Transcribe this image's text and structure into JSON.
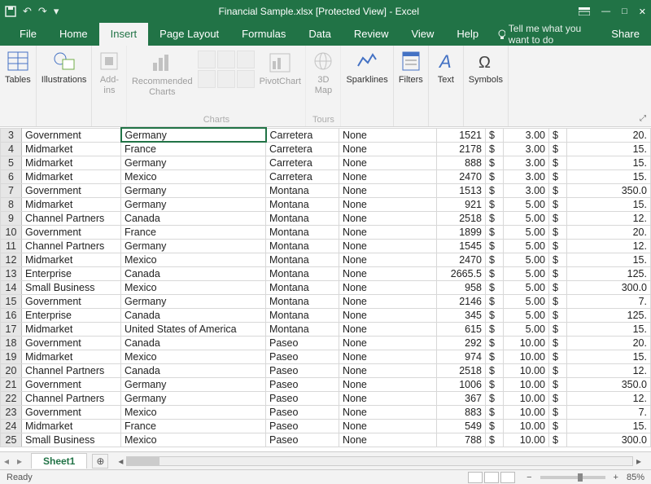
{
  "title": "Financial Sample.xlsx  [Protected View]  -  Excel",
  "qat": {
    "undo": "↶",
    "redo": "↷"
  },
  "menu": {
    "file": "File",
    "home": "Home",
    "insert": "Insert",
    "page_layout": "Page Layout",
    "formulas": "Formulas",
    "data": "Data",
    "review": "Review",
    "view": "View",
    "help": "Help",
    "tellme": "Tell me what you want to do",
    "share": "Share"
  },
  "ribbon": {
    "tables": "Tables",
    "illustrations": "Illustrations",
    "addins": "Add-\nins",
    "recommended": "Recommended\nCharts",
    "charts_group": "Charts",
    "pivotchart": "PivotChart",
    "map": "3D\nMap",
    "tours_group": "Tours",
    "sparklines": "Sparklines",
    "filters": "Filters",
    "text": "Text",
    "symbols": "Symbols"
  },
  "rows": [
    {
      "n": 3,
      "seg": "Government",
      "cty": "Germany",
      "prod": "Carretera",
      "disc": "None",
      "u": "1521",
      "c1": "$",
      "p": "3.00",
      "c2": "$",
      "v": "20."
    },
    {
      "n": 4,
      "seg": "Midmarket",
      "cty": "France",
      "prod": "Carretera",
      "disc": "None",
      "u": "2178",
      "c1": "$",
      "p": "3.00",
      "c2": "$",
      "v": "15."
    },
    {
      "n": 5,
      "seg": "Midmarket",
      "cty": "Germany",
      "prod": "Carretera",
      "disc": "None",
      "u": "888",
      "c1": "$",
      "p": "3.00",
      "c2": "$",
      "v": "15."
    },
    {
      "n": 6,
      "seg": "Midmarket",
      "cty": "Mexico",
      "prod": "Carretera",
      "disc": "None",
      "u": "2470",
      "c1": "$",
      "p": "3.00",
      "c2": "$",
      "v": "15."
    },
    {
      "n": 7,
      "seg": "Government",
      "cty": "Germany",
      "prod": "Montana",
      "disc": "None",
      "u": "1513",
      "c1": "$",
      "p": "3.00",
      "c2": "$",
      "v": "350.0"
    },
    {
      "n": 8,
      "seg": "Midmarket",
      "cty": "Germany",
      "prod": "Montana",
      "disc": "None",
      "u": "921",
      "c1": "$",
      "p": "5.00",
      "c2": "$",
      "v": "15."
    },
    {
      "n": 9,
      "seg": "Channel Partners",
      "cty": "Canada",
      "prod": "Montana",
      "disc": "None",
      "u": "2518",
      "c1": "$",
      "p": "5.00",
      "c2": "$",
      "v": "12."
    },
    {
      "n": 10,
      "seg": "Government",
      "cty": "France",
      "prod": "Montana",
      "disc": "None",
      "u": "1899",
      "c1": "$",
      "p": "5.00",
      "c2": "$",
      "v": "20."
    },
    {
      "n": 11,
      "seg": "Channel Partners",
      "cty": "Germany",
      "prod": "Montana",
      "disc": "None",
      "u": "1545",
      "c1": "$",
      "p": "5.00",
      "c2": "$",
      "v": "12."
    },
    {
      "n": 12,
      "seg": "Midmarket",
      "cty": "Mexico",
      "prod": "Montana",
      "disc": "None",
      "u": "2470",
      "c1": "$",
      "p": "5.00",
      "c2": "$",
      "v": "15."
    },
    {
      "n": 13,
      "seg": "Enterprise",
      "cty": "Canada",
      "prod": "Montana",
      "disc": "None",
      "u": "2665.5",
      "c1": "$",
      "p": "5.00",
      "c2": "$",
      "v": "125."
    },
    {
      "n": 14,
      "seg": "Small Business",
      "cty": "Mexico",
      "prod": "Montana",
      "disc": "None",
      "u": "958",
      "c1": "$",
      "p": "5.00",
      "c2": "$",
      "v": "300.0"
    },
    {
      "n": 15,
      "seg": "Government",
      "cty": "Germany",
      "prod": "Montana",
      "disc": "None",
      "u": "2146",
      "c1": "$",
      "p": "5.00",
      "c2": "$",
      "v": "7."
    },
    {
      "n": 16,
      "seg": "Enterprise",
      "cty": "Canada",
      "prod": "Montana",
      "disc": "None",
      "u": "345",
      "c1": "$",
      "p": "5.00",
      "c2": "$",
      "v": "125."
    },
    {
      "n": 17,
      "seg": "Midmarket",
      "cty": "United States of America",
      "prod": "Montana",
      "disc": "None",
      "u": "615",
      "c1": "$",
      "p": "5.00",
      "c2": "$",
      "v": "15."
    },
    {
      "n": 18,
      "seg": "Government",
      "cty": "Canada",
      "prod": "Paseo",
      "disc": "None",
      "u": "292",
      "c1": "$",
      "p": "10.00",
      "c2": "$",
      "v": "20."
    },
    {
      "n": 19,
      "seg": "Midmarket",
      "cty": "Mexico",
      "prod": "Paseo",
      "disc": "None",
      "u": "974",
      "c1": "$",
      "p": "10.00",
      "c2": "$",
      "v": "15."
    },
    {
      "n": 20,
      "seg": "Channel Partners",
      "cty": "Canada",
      "prod": "Paseo",
      "disc": "None",
      "u": "2518",
      "c1": "$",
      "p": "10.00",
      "c2": "$",
      "v": "12."
    },
    {
      "n": 21,
      "seg": "Government",
      "cty": "Germany",
      "prod": "Paseo",
      "disc": "None",
      "u": "1006",
      "c1": "$",
      "p": "10.00",
      "c2": "$",
      "v": "350.0"
    },
    {
      "n": 22,
      "seg": "Channel Partners",
      "cty": "Germany",
      "prod": "Paseo",
      "disc": "None",
      "u": "367",
      "c1": "$",
      "p": "10.00",
      "c2": "$",
      "v": "12."
    },
    {
      "n": 23,
      "seg": "Government",
      "cty": "Mexico",
      "prod": "Paseo",
      "disc": "None",
      "u": "883",
      "c1": "$",
      "p": "10.00",
      "c2": "$",
      "v": "7."
    },
    {
      "n": 24,
      "seg": "Midmarket",
      "cty": "France",
      "prod": "Paseo",
      "disc": "None",
      "u": "549",
      "c1": "$",
      "p": "10.00",
      "c2": "$",
      "v": "15."
    },
    {
      "n": 25,
      "seg": "Small Business",
      "cty": "Mexico",
      "prod": "Paseo",
      "disc": "None",
      "u": "788",
      "c1": "$",
      "p": "10.00",
      "c2": "$",
      "v": "300.0"
    }
  ],
  "sheet_tab": "Sheet1",
  "status": {
    "ready": "Ready",
    "zoom": "85%"
  }
}
